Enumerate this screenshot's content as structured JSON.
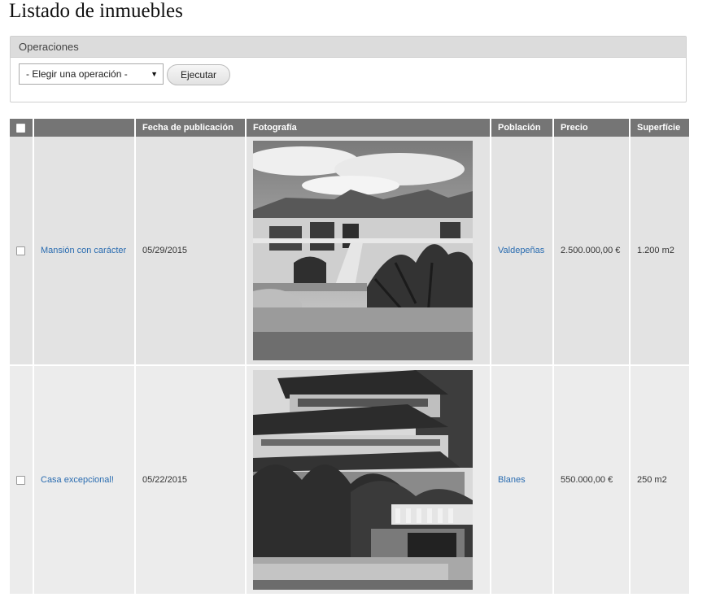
{
  "page": {
    "title": "Listado de inmuebles"
  },
  "operations": {
    "legend": "Operaciones",
    "select_value": "- Elegir una operación -",
    "execute_label": "Ejecutar"
  },
  "table": {
    "headers": {
      "title": "",
      "date": "Fecha de publicación",
      "photo": "Fotografía",
      "town": "Población",
      "price": "Precio",
      "area": "Superfície"
    },
    "rows": [
      {
        "title": "Mansión con carácter",
        "date": "05/29/2015",
        "town": "Valdepeñas",
        "price": "2.500.000,00 €",
        "area": "1.200 m2"
      },
      {
        "title": "Casa excepcional!",
        "date": "05/22/2015",
        "town": "Blanes",
        "price": "550.000,00 €",
        "area": "250 m2"
      }
    ]
  }
}
